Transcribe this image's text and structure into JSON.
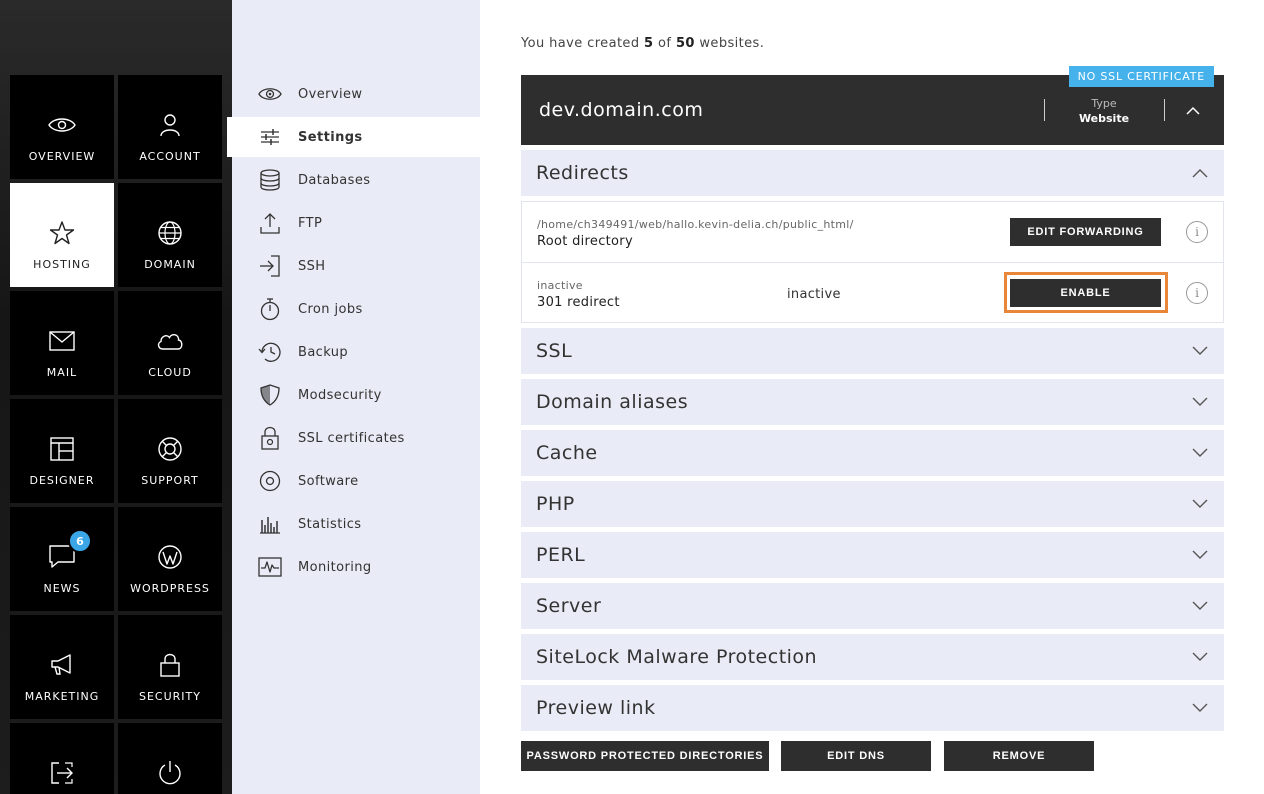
{
  "tiles": [
    {
      "id": "overview",
      "label": "OVERVIEW",
      "icon": "eye-icon",
      "active": false
    },
    {
      "id": "account",
      "label": "ACCOUNT",
      "icon": "user-icon",
      "active": false
    },
    {
      "id": "hosting",
      "label": "HOSTING",
      "icon": "star-icon",
      "active": true
    },
    {
      "id": "domain",
      "label": "DOMAIN",
      "icon": "globe-icon",
      "active": false
    },
    {
      "id": "mail",
      "label": "MAIL",
      "icon": "envelope-icon",
      "active": false
    },
    {
      "id": "cloud",
      "label": "CLOUD",
      "icon": "cloud-icon",
      "active": false
    },
    {
      "id": "designer",
      "label": "DESIGNER",
      "icon": "layout-icon",
      "active": false
    },
    {
      "id": "support",
      "label": "SUPPORT",
      "icon": "lifebuoy-icon",
      "active": false
    },
    {
      "id": "news",
      "label": "NEWS",
      "icon": "chat-bubble-icon",
      "active": false,
      "badge": "6"
    },
    {
      "id": "wordpress",
      "label": "WORDPRESS",
      "icon": "wordpress-icon",
      "active": false
    },
    {
      "id": "marketing",
      "label": "MARKETING",
      "icon": "megaphone-icon",
      "active": false
    },
    {
      "id": "security",
      "label": "SECURITY",
      "icon": "lock-icon",
      "active": false
    },
    {
      "id": "logout",
      "label": "",
      "icon": "sign-out-icon",
      "active": false
    },
    {
      "id": "power",
      "label": "",
      "icon": "power-icon",
      "active": false
    }
  ],
  "subnav": [
    {
      "label": "Overview",
      "icon": "eye-icon",
      "active": false
    },
    {
      "label": "Settings",
      "icon": "sliders-icon",
      "active": true
    },
    {
      "label": "Databases",
      "icon": "database-icon",
      "active": false
    },
    {
      "label": "FTP",
      "icon": "upload-icon",
      "active": false
    },
    {
      "label": "SSH",
      "icon": "sign-in-icon",
      "active": false
    },
    {
      "label": "Cron jobs",
      "icon": "stopwatch-icon",
      "active": false
    },
    {
      "label": "Backup",
      "icon": "history-icon",
      "active": false
    },
    {
      "label": "Modsecurity",
      "icon": "shield-icon",
      "active": false
    },
    {
      "label": "SSL certificates",
      "icon": "certificate-lock-icon",
      "active": false
    },
    {
      "label": "Software",
      "icon": "disc-icon",
      "active": false
    },
    {
      "label": "Statistics",
      "icon": "bar-chart-icon",
      "active": false
    },
    {
      "label": "Monitoring",
      "icon": "pulse-icon",
      "active": false
    }
  ],
  "summary": {
    "prefix": "You have created",
    "created": "5",
    "of_word": "of",
    "total": "50",
    "suffix": "websites."
  },
  "site": {
    "domain": "dev.domain.com",
    "ssl_tag": "NO SSL CERTIFICATE",
    "type_label": "Type",
    "type_value": "Website"
  },
  "redirects": {
    "title": "Redirects",
    "rows": [
      {
        "small": "/home/ch349491/web/hallo.kevin-delia.ch/public_html/",
        "main": "Root directory",
        "status": "",
        "button": "EDIT FORWARDING"
      },
      {
        "small": "inactive",
        "main": "301 redirect",
        "status": "inactive",
        "button": "ENABLE"
      }
    ],
    "info_glyph": "i"
  },
  "sections": [
    "SSL",
    "Domain aliases",
    "Cache",
    "PHP",
    "PERL",
    "Server",
    "SiteLock Malware Protection",
    "Preview link"
  ],
  "actions": {
    "password_dirs": "PASSWORD PROTECTED DIRECTORIES",
    "edit_dns": "EDIT DNS",
    "remove": "REMOVE"
  },
  "colors": {
    "accent_blue": "#45b2ec",
    "highlight_orange": "#e8873a",
    "dark": "#2e2e2e",
    "panel": "#e9ecf6"
  }
}
